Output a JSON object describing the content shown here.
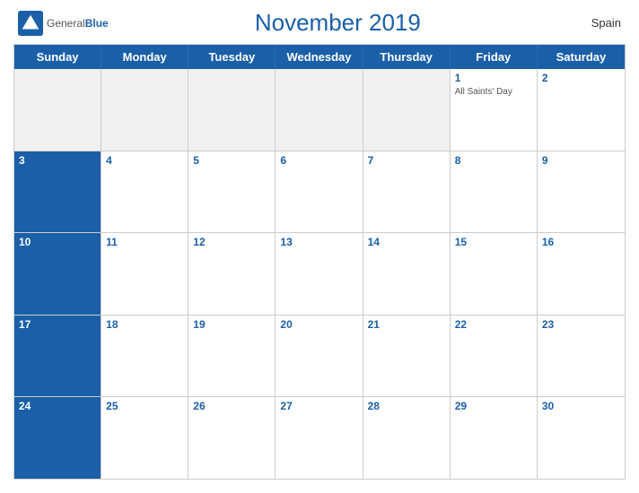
{
  "header": {
    "logo": {
      "general": "General",
      "blue": "Blue"
    },
    "title": "November 2019",
    "country": "Spain"
  },
  "calendar": {
    "days_of_week": [
      "Sunday",
      "Monday",
      "Tuesday",
      "Wednesday",
      "Thursday",
      "Friday",
      "Saturday"
    ],
    "weeks": [
      [
        {
          "day": "",
          "empty": true
        },
        {
          "day": "",
          "empty": true
        },
        {
          "day": "",
          "empty": true
        },
        {
          "day": "",
          "empty": true
        },
        {
          "day": "",
          "empty": true
        },
        {
          "day": "1",
          "event": "All Saints' Day"
        },
        {
          "day": "2"
        }
      ],
      [
        {
          "day": "3"
        },
        {
          "day": "4"
        },
        {
          "day": "5"
        },
        {
          "day": "6"
        },
        {
          "day": "7"
        },
        {
          "day": "8"
        },
        {
          "day": "9"
        }
      ],
      [
        {
          "day": "10"
        },
        {
          "day": "11"
        },
        {
          "day": "12"
        },
        {
          "day": "13"
        },
        {
          "day": "14"
        },
        {
          "day": "15"
        },
        {
          "day": "16"
        }
      ],
      [
        {
          "day": "17"
        },
        {
          "day": "18"
        },
        {
          "day": "19"
        },
        {
          "day": "20"
        },
        {
          "day": "21"
        },
        {
          "day": "22"
        },
        {
          "day": "23"
        }
      ],
      [
        {
          "day": "24"
        },
        {
          "day": "25"
        },
        {
          "day": "26"
        },
        {
          "day": "27"
        },
        {
          "day": "28"
        },
        {
          "day": "29"
        },
        {
          "day": "30"
        }
      ]
    ]
  }
}
